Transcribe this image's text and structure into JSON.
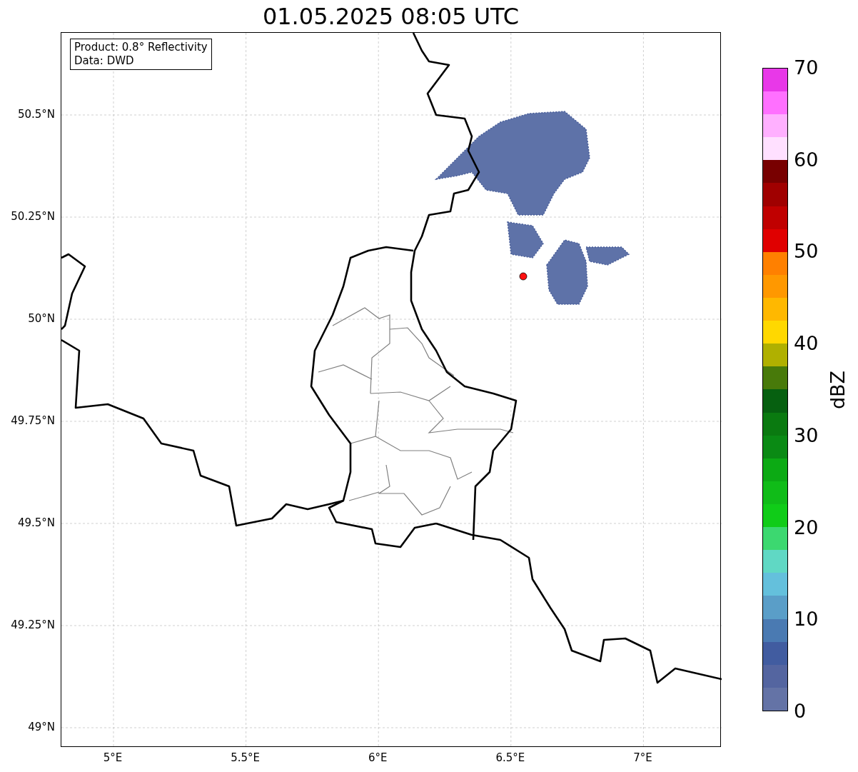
{
  "title": "01.05.2025 08:05 UTC",
  "info_box": [
    "Product: 0.8° Reflectivity",
    "Data: DWD"
  ],
  "y_ticks": [
    "50.5°N",
    "50.25°N",
    "50°N",
    "49.75°N",
    "49.5°N",
    "49.25°N",
    "49°N"
  ],
  "x_ticks": [
    "5°E",
    "5.5°E",
    "6°E",
    "6.5°E",
    "7°E"
  ],
  "colorbar": {
    "label": "dBZ",
    "ticks": [
      "70",
      "60",
      "50",
      "40",
      "30",
      "20",
      "10",
      "0"
    ],
    "bins": [
      {
        "color": "#6473a6"
      },
      {
        "color": "#5465a0"
      },
      {
        "color": "#415ca0"
      },
      {
        "color": "#4a7ab2"
      },
      {
        "color": "#5a9ec8"
      },
      {
        "color": "#64c0dc"
      },
      {
        "color": "#60d8c4"
      },
      {
        "color": "#3cd870"
      },
      {
        "color": "#10cc18"
      },
      {
        "color": "#10bc18"
      },
      {
        "color": "#0caa14"
      },
      {
        "color": "#0a8a14"
      },
      {
        "color": "#0a7a10"
      },
      {
        "color": "#066010"
      },
      {
        "color": "#487a0a"
      },
      {
        "color": "#b0b000"
      },
      {
        "color": "#ffd800"
      },
      {
        "color": "#ffb800"
      },
      {
        "color": "#ff9800"
      },
      {
        "color": "#ff8000"
      },
      {
        "color": "#e00000"
      },
      {
        "color": "#c00000"
      },
      {
        "color": "#a00000"
      },
      {
        "color": "#780000"
      },
      {
        "color": "#ffe0ff"
      },
      {
        "color": "#ffb0ff"
      },
      {
        "color": "#ff70ff"
      },
      {
        "color": "#e838e8"
      }
    ]
  }
}
